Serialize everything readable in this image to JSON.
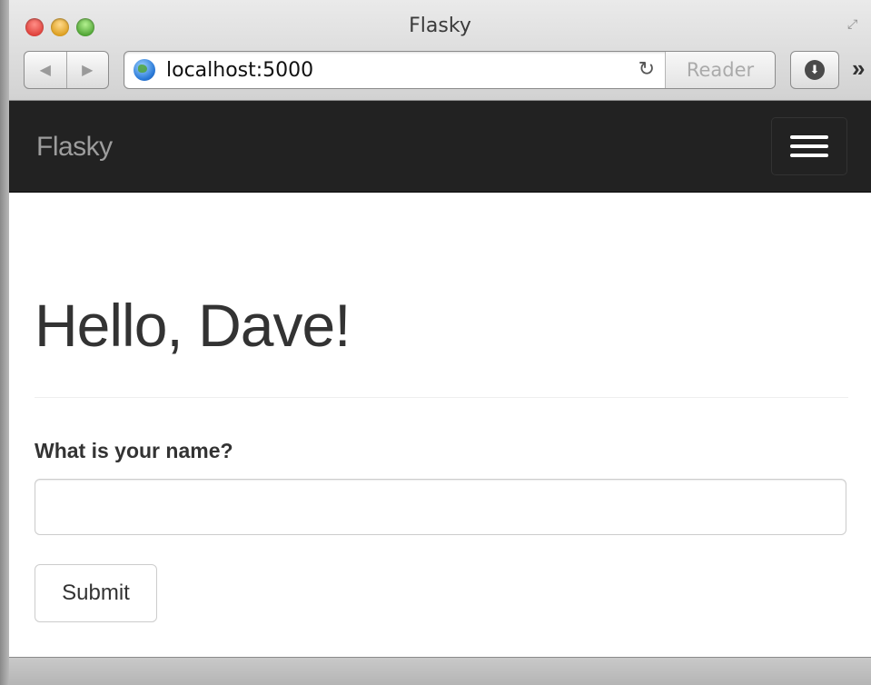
{
  "window": {
    "title": "Flasky"
  },
  "toolbar": {
    "back_glyph": "◀",
    "forward_glyph": "▶",
    "url": "localhost:5000",
    "reload_glyph": "↻",
    "reader_label": "Reader",
    "download_glyph": "⬇",
    "overflow_glyph": "»",
    "fullscreen_glyph": "⤢"
  },
  "navbar": {
    "brand": "Flasky"
  },
  "main": {
    "heading": "Hello, Dave!",
    "form": {
      "name_label": "What is your name?",
      "name_value": "",
      "submit_label": "Submit"
    }
  },
  "colors": {
    "navbar_bg": "#222222",
    "brand_text": "#9d9d9d",
    "heading_text": "#333333"
  }
}
